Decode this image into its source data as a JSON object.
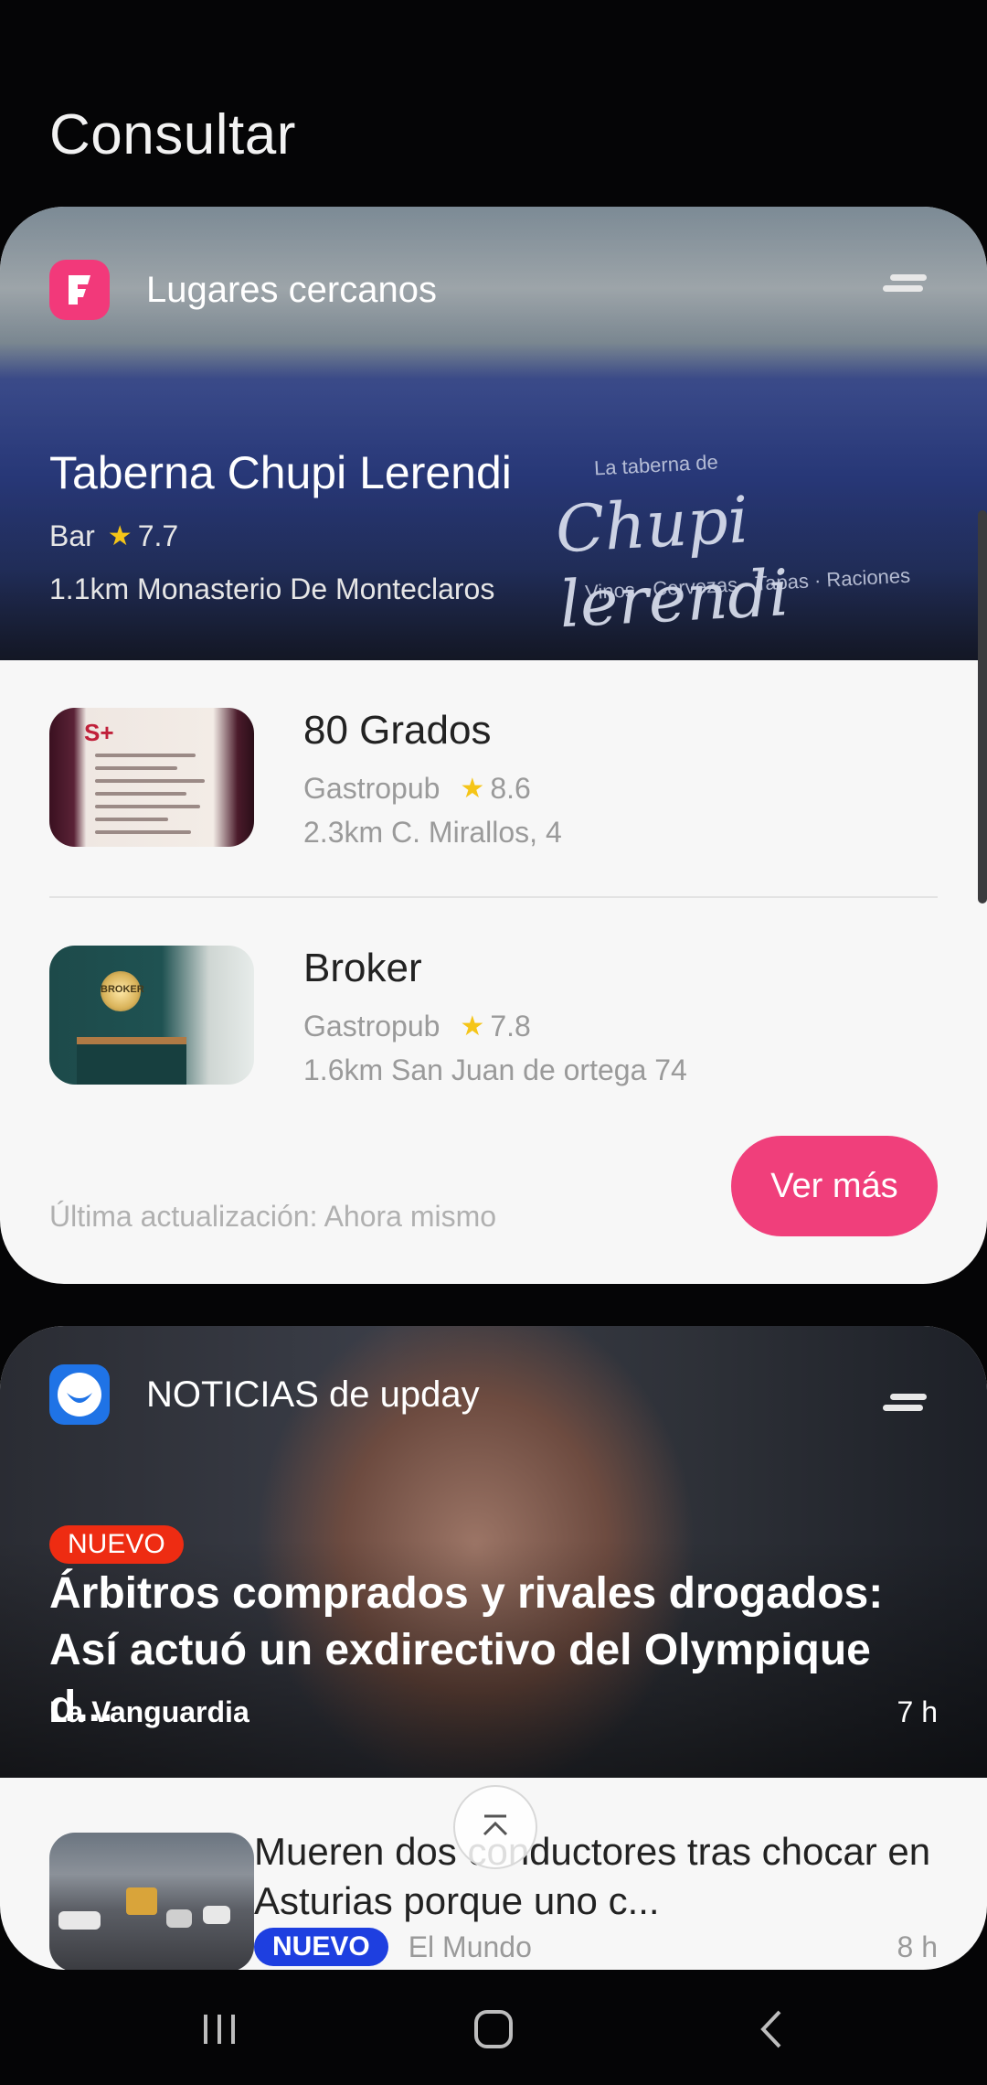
{
  "page": {
    "title": "Consultar"
  },
  "places_card": {
    "header_title": "Lugares cercanos",
    "icon": "foursquare-icon",
    "featured": {
      "name": "Taberna Chupi Lerendi",
      "type": "Bar",
      "rating": "7.7",
      "distance_address": "1.1km Monasterio De Monteclaros",
      "sign_text": "Chupi lerendi",
      "sign_top": "La taberna de",
      "sign_sub": "Vinos · Cervezas · Tapas · Raciones"
    },
    "items": [
      {
        "name": "80 Grados",
        "type": "Gastropub",
        "rating": "8.6",
        "distance_address": "2.3km C. Mirallos, 4",
        "thumb_text": "S+"
      },
      {
        "name": "Broker",
        "type": "Gastropub",
        "rating": "7.8",
        "distance_address": "1.6km San Juan de ortega 74",
        "thumb_text": "BROKER"
      }
    ],
    "last_update": "Última actualización: Ahora mismo",
    "more_button": "Ver más",
    "accent_color": "#f03f7b"
  },
  "news_card": {
    "header_title": "NOTICIAS de upday",
    "icon": "upday-icon",
    "featured": {
      "badge": "NUEVO",
      "title": "Árbitros comprados y rivales drogados: Así actuó un exdirectivo del Olympique d...",
      "source": "La Vanguardia",
      "time": "7 h"
    },
    "items": [
      {
        "title": "Mueren dos conductores tras chocar en Asturias porque uno c...",
        "badge": "NUEVO",
        "source": "El Mundo",
        "time": "8 h"
      }
    ]
  },
  "navbar": {
    "recents": "recents-icon",
    "home": "home-icon",
    "back": "back-icon"
  }
}
